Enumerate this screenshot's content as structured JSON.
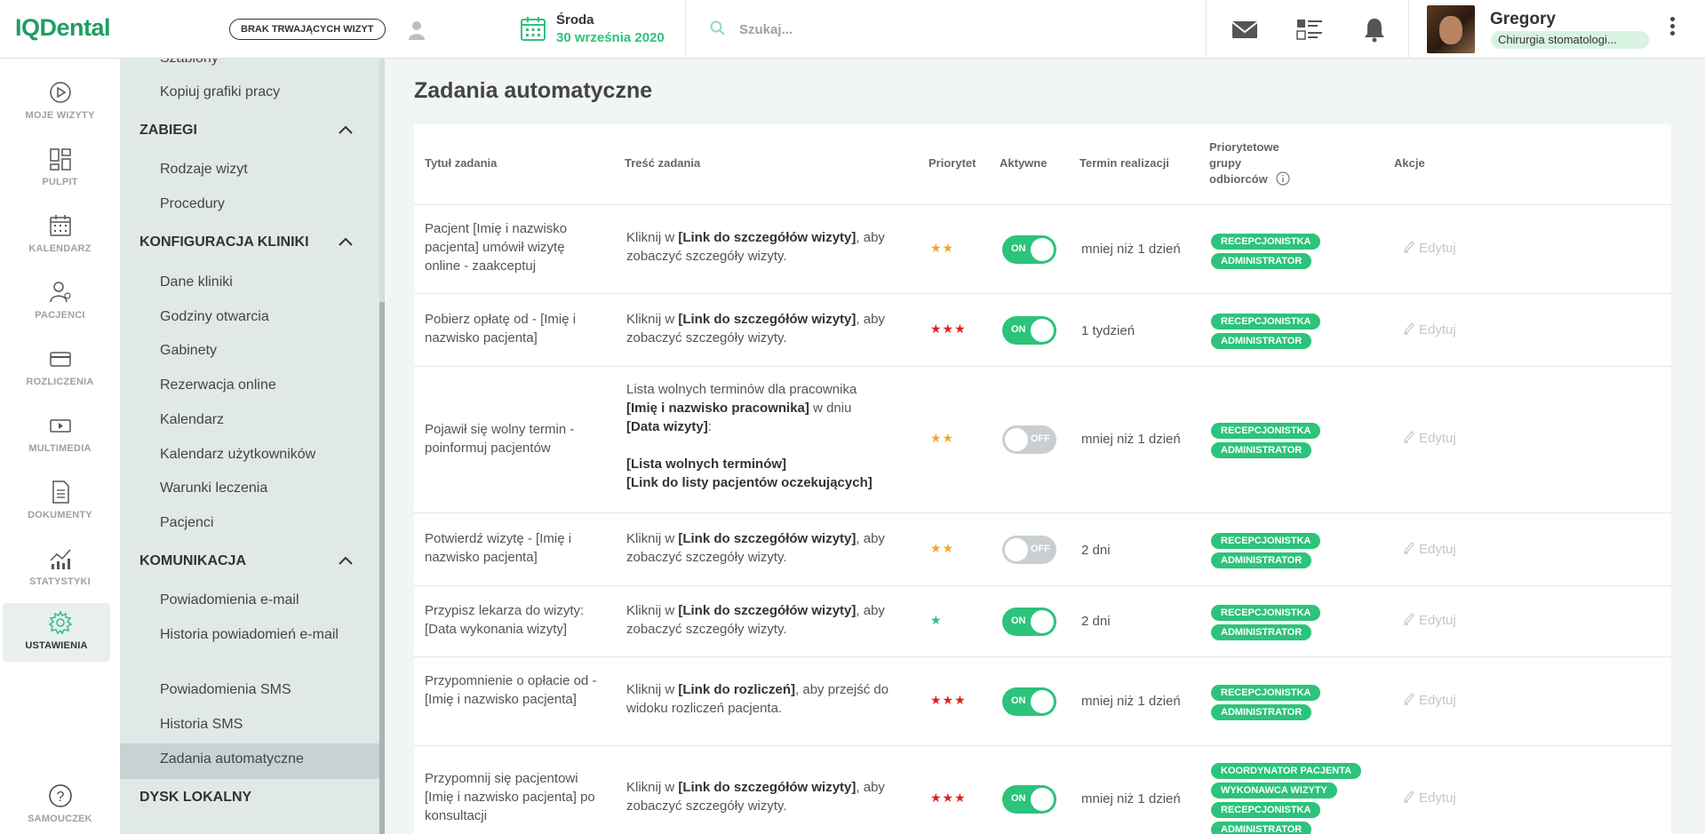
{
  "app": {
    "logo": "IQDental"
  },
  "header": {
    "no_visits_label": "BRAK TRWAJĄCYCH WIZYT",
    "date_day": "Środa",
    "date_full": "30 września 2020",
    "search_placeholder": "Szukaj...",
    "user_name": "Gregory",
    "user_role": "Chirurgia stomatologi..."
  },
  "nav": {
    "items": [
      {
        "label": "MOJE WIZYTY",
        "icon": "play-circle-icon"
      },
      {
        "label": "PULPIT",
        "icon": "dashboard-icon"
      },
      {
        "label": "KALENDARZ",
        "icon": "calendar-icon"
      },
      {
        "label": "PACJENCI",
        "icon": "patients-icon"
      },
      {
        "label": "ROZLICZENIA",
        "icon": "credit-card-icon"
      },
      {
        "label": "MULTIMEDIA",
        "icon": "multimedia-icon"
      },
      {
        "label": "DOKUMENTY",
        "icon": "document-icon"
      },
      {
        "label": "STATYSTYKI",
        "icon": "statistics-icon"
      },
      {
        "label": "USTAWIENIA",
        "icon": "settings-gear-icon"
      }
    ],
    "help_label": "SAMOUCZEK"
  },
  "submenu": {
    "top_partial": "Szablony",
    "copy_schedules": "Kopiuj grafiki pracy",
    "section_zabiegi": "ZABIEGI",
    "zabiegi_items": [
      "Rodzaje wizyt",
      "Procedury"
    ],
    "section_konfig": "KONFIGURACJA KLINIKI",
    "konfig_items": [
      "Dane kliniki",
      "Godziny otwarcia",
      "Gabinety",
      "Rezerwacja online",
      "Kalendarz",
      "Kalendarz użytkowników",
      "Warunki leczenia",
      "Pacjenci"
    ],
    "section_komunikacja": "KOMUNIKACJA",
    "komunikacja_items": [
      "Powiadomienia e-mail",
      "Historia powiadomień e-mail",
      "Powiadomienia SMS",
      "Historia SMS",
      "Zadania automatyczne"
    ],
    "section_dysk": "DYSK LOKALNY"
  },
  "main": {
    "title": "Zadania automatyczne",
    "columns": {
      "title": "Tytuł zadania",
      "content": "Treść zadania",
      "priority": "Priorytet",
      "active": "Aktywne",
      "deadline": "Termin realizacji",
      "groups_1": "Priorytetowe",
      "groups_2": "grupy",
      "groups_3": "odbiorców",
      "actions": "Akcje"
    },
    "edit_label": "Edytuj",
    "rows": [
      {
        "title": "Pacjent [Imię i nazwisko pacjenta] umówił wizytę online - zaakceptuj",
        "c1": "Kliknij w ",
        "c1b": "[Link do szczegółów wizyty]",
        "c1e": ", aby zobaczyć szczegóły wizyty.",
        "stars": "★★",
        "star_color": "#f5a623",
        "active": "ON",
        "deadline": "mniej niż 1 dzień",
        "groups": [
          "RECEPCJONISTKA",
          "ADMINISTRATOR"
        ]
      },
      {
        "title": "Pobierz opłatę od - [Imię i nazwisko pacjenta]",
        "c1": "Kliknij w ",
        "c1b": "[Link do szczegółów wizyty]",
        "c1e": ", aby zobaczyć szczegóły wizyty.",
        "stars": "★★★",
        "star_color": "#e0201d",
        "active": "ON",
        "deadline": "1 tydzień",
        "groups": [
          "RECEPCJONISTKA",
          "ADMINISTRATOR"
        ]
      },
      {
        "title": "Pojawił się wolny termin - poinformuj pacjentów",
        "c1": "Lista wolnych terminów dla pracownika",
        "c2b": "[Imię i nazwisko pracownika]",
        "c2e": " w dniu",
        "c3b": "[Data wizyty]",
        "c3e": ":",
        "c4b": "[Lista wolnych terminów]",
        "c5b": "[Link do listy pacjentów oczekujących]",
        "stars": "★★",
        "star_color": "#f5a623",
        "active": "OFF",
        "deadline": "mniej niż 1 dzień",
        "groups": [
          "RECEPCJONISTKA",
          "ADMINISTRATOR"
        ]
      },
      {
        "title": "Potwierdź wizytę - [Imię i nazwisko pacjenta]",
        "c1": "Kliknij w ",
        "c1b": "[Link do szczegółów wizyty]",
        "c1e": ", aby zobaczyć szczegóły wizyty.",
        "stars": "★★",
        "star_color": "#f5a623",
        "active": "OFF",
        "deadline": "2 dni",
        "groups": [
          "RECEPCJONISTKA",
          "ADMINISTRATOR"
        ]
      },
      {
        "title": "Przypisz lekarza do wizyty: [Data wykonania wizyty]",
        "c1": "Kliknij w ",
        "c1b": "[Link do szczegółów wizyty]",
        "c1e": ", aby zobaczyć szczegóły wizyty.",
        "stars": "★",
        "star_color": "#2cc37b",
        "active": "ON",
        "deadline": "2 dni",
        "groups": [
          "RECEPCJONISTKA",
          "ADMINISTRATOR"
        ]
      },
      {
        "title": "Przypomnienie o opłacie od - [Imię i nazwisko pacjenta]",
        "c1": "Kliknij w ",
        "c1b": "[Link do rozliczeń]",
        "c1e": ", aby przejść do widoku rozliczeń pacjenta.",
        "stars": "★★★",
        "star_color": "#e0201d",
        "active": "ON",
        "deadline": "mniej niż 1 dzień",
        "groups": [
          "RECEPCJONISTKA",
          "ADMINISTRATOR"
        ]
      },
      {
        "title": "Przypomnij się pacjentowi [Imię i nazwisko pacjenta] po konsultacji",
        "c1": "Kliknij w ",
        "c1b": "[Link do szczegółów wizyty]",
        "c1e": ", aby zobaczyć szczegóły wizyty.",
        "stars": "★★★",
        "star_color": "#e0201d",
        "active": "ON",
        "deadline": "mniej niż 1 dzień",
        "groups": [
          "KOORDYNATOR PACJENTA",
          "WYKONAWCA WIZYTY",
          "RECEPCJONISTKA",
          "ADMINISTRATOR"
        ]
      }
    ]
  },
  "colors": {
    "accent": "#2cc37b",
    "brand": "#1f9d63",
    "submenu_bg": "#e1e8e8"
  }
}
